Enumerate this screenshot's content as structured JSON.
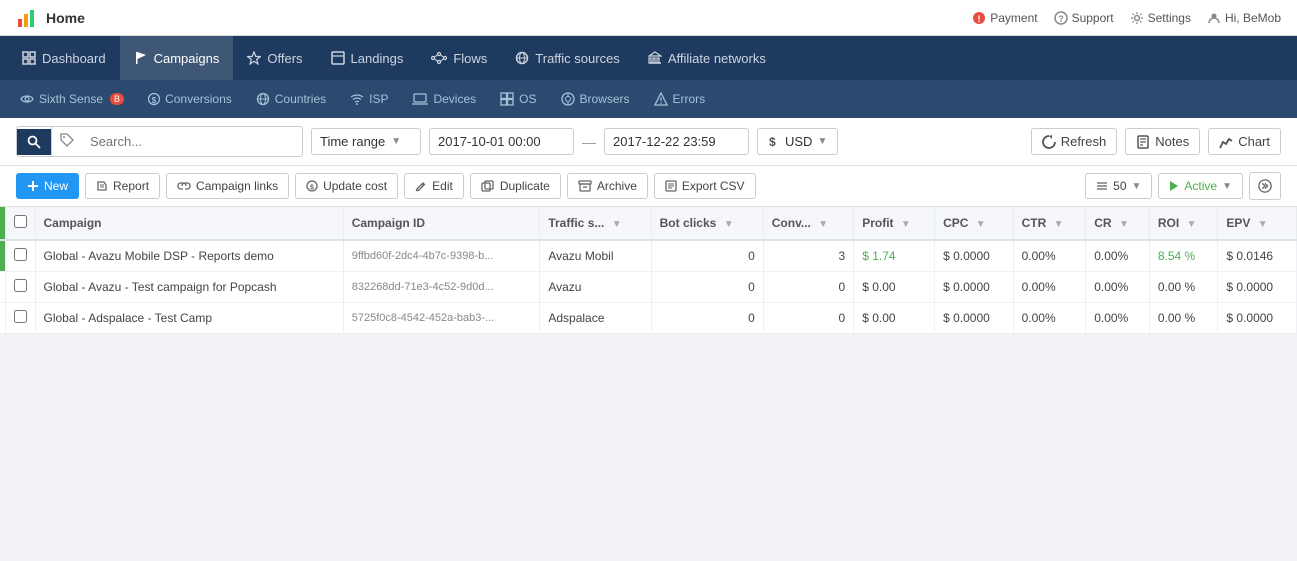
{
  "topbar": {
    "app_name": "Home",
    "payment": "Payment",
    "support": "Support",
    "settings": "Settings",
    "user": "Hi, BeMob"
  },
  "navbar": {
    "items": [
      {
        "id": "dashboard",
        "label": "Dashboard",
        "icon": "grid"
      },
      {
        "id": "campaigns",
        "label": "Campaigns",
        "icon": "flag",
        "active": true
      },
      {
        "id": "offers",
        "label": "Offers",
        "icon": "star"
      },
      {
        "id": "landings",
        "label": "Landings",
        "icon": "layout"
      },
      {
        "id": "flows",
        "label": "Flows",
        "icon": "flow"
      },
      {
        "id": "traffic-sources",
        "label": "Traffic sources",
        "icon": "globe"
      },
      {
        "id": "affiliate-networks",
        "label": "Affiliate networks",
        "icon": "bank"
      }
    ]
  },
  "subnav": {
    "items": [
      {
        "id": "sixth-sense",
        "label": "Sixth Sense",
        "badge": "B",
        "icon": "eye"
      },
      {
        "id": "conversions",
        "label": "Conversions",
        "icon": "dollar"
      },
      {
        "id": "countries",
        "label": "Countries",
        "icon": "globe2"
      },
      {
        "id": "isp",
        "label": "ISP",
        "icon": "wifi"
      },
      {
        "id": "devices",
        "label": "Devices",
        "icon": "laptop"
      },
      {
        "id": "os",
        "label": "OS",
        "icon": "windows"
      },
      {
        "id": "browsers",
        "label": "Browsers",
        "icon": "browser"
      },
      {
        "id": "errors",
        "label": "Errors",
        "icon": "warning"
      }
    ]
  },
  "toolbar": {
    "search_placeholder": "Search...",
    "time_range_label": "Time range",
    "date_from": "2017-10-01 00:00",
    "date_to": "2017-12-22 23:59",
    "currency": "USD",
    "refresh_label": "Refresh",
    "notes_label": "Notes",
    "chart_label": "Chart"
  },
  "actionbar": {
    "new_label": "New",
    "report_label": "Report",
    "campaign_links_label": "Campaign links",
    "update_cost_label": "Update cost",
    "edit_label": "Edit",
    "duplicate_label": "Duplicate",
    "archive_label": "Archive",
    "export_csv_label": "Export CSV",
    "per_page": "50",
    "active_label": "Active"
  },
  "table": {
    "columns": [
      {
        "id": "campaign",
        "label": "Campaign"
      },
      {
        "id": "campaign_id",
        "label": "Campaign ID"
      },
      {
        "id": "traffic_source",
        "label": "Traffic s..."
      },
      {
        "id": "bot_clicks",
        "label": "Bot clicks"
      },
      {
        "id": "conv",
        "label": "Conv..."
      },
      {
        "id": "profit",
        "label": "Profit"
      },
      {
        "id": "cpc",
        "label": "CPC"
      },
      {
        "id": "ctr",
        "label": "CTR"
      },
      {
        "id": "cr",
        "label": "CR"
      },
      {
        "id": "roi",
        "label": "ROI"
      },
      {
        "id": "epv",
        "label": "EPV"
      }
    ],
    "rows": [
      {
        "indicator": true,
        "campaign": "Global - Avazu Mobile DSP - Reports demo",
        "campaign_id": "9ffbd60f-2dc4-4b7c-9398-b...",
        "traffic_source": "Avazu Mobil",
        "bot_clicks": "0",
        "conv": "3",
        "profit": "$ 1.74",
        "profit_class": "positive",
        "cpc": "$ 0.0000",
        "ctr": "0.00%",
        "cr": "0.00%",
        "roi": "8.54 %",
        "roi_class": "positive",
        "epv": "$ 0.0146"
      },
      {
        "indicator": false,
        "campaign": "Global - Avazu - Test campaign for Popcash",
        "campaign_id": "832268dd-71e3-4c52-9d0d...",
        "traffic_source": "Avazu",
        "bot_clicks": "0",
        "conv": "0",
        "profit": "$ 0.00",
        "profit_class": "",
        "cpc": "$ 0.0000",
        "ctr": "0.00%",
        "cr": "0.00%",
        "roi": "0.00 %",
        "roi_class": "",
        "epv": "$ 0.0000"
      },
      {
        "indicator": false,
        "campaign": "Global - Adspalace - Test Camp",
        "campaign_id": "5725f0c8-4542-452a-bab3-...",
        "traffic_source": "Adspalace",
        "bot_clicks": "0",
        "conv": "0",
        "profit": "$ 0.00",
        "profit_class": "",
        "cpc": "$ 0.0000",
        "ctr": "0.00%",
        "cr": "0.00%",
        "roi": "0.00 %",
        "roi_class": "",
        "epv": "$ 0.0000"
      }
    ]
  }
}
